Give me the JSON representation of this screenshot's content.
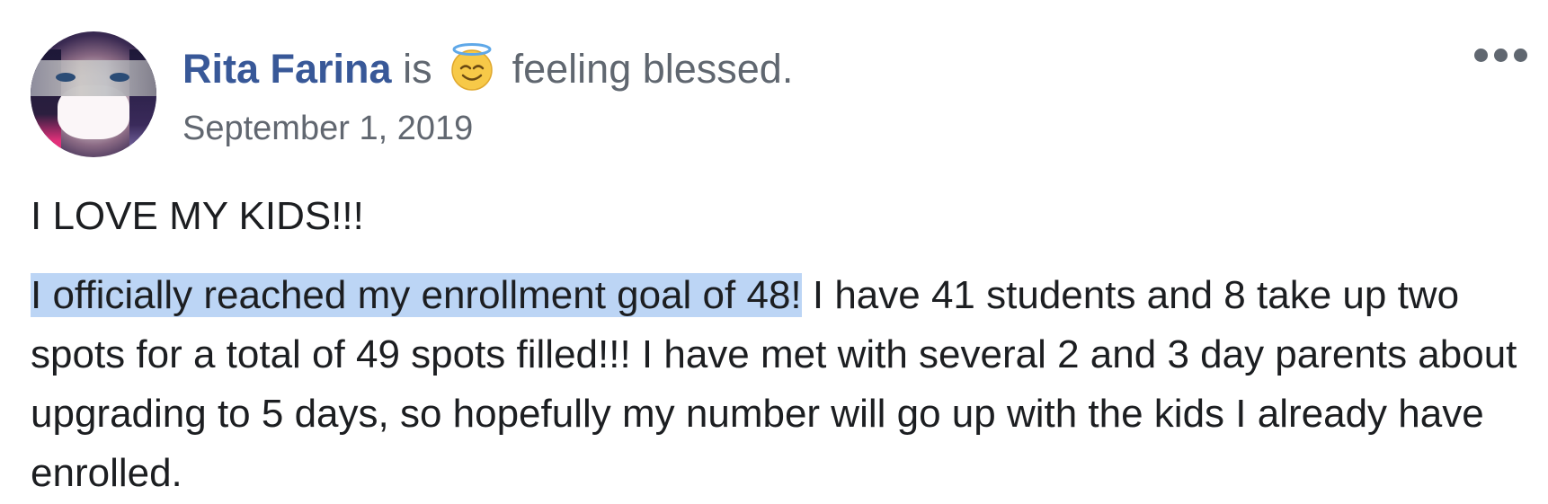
{
  "post": {
    "author": "Rita Farina",
    "verb": "is",
    "feeling": "feeling blessed.",
    "feeling_icon": "smiling-face-with-halo-icon",
    "date": "September 1, 2019",
    "heading": "I LOVE MY KIDS!!!",
    "highlighted_text": "I officially reached my enrollment goal of 48!",
    "body_text": " I have 41 students and 8 take up two spots for a total of 49 spots filled!!! I have met with several 2 and 3 day parents about upgrading to 5 days, so hopefully my number will go up with the kids I already have enrolled."
  },
  "menu": {
    "icon": "more-options-icon"
  },
  "colors": {
    "author_link": "#385898",
    "secondary_text": "#606770",
    "body_text": "#1c1e21",
    "selection_highlight": "#bcd5f5"
  }
}
